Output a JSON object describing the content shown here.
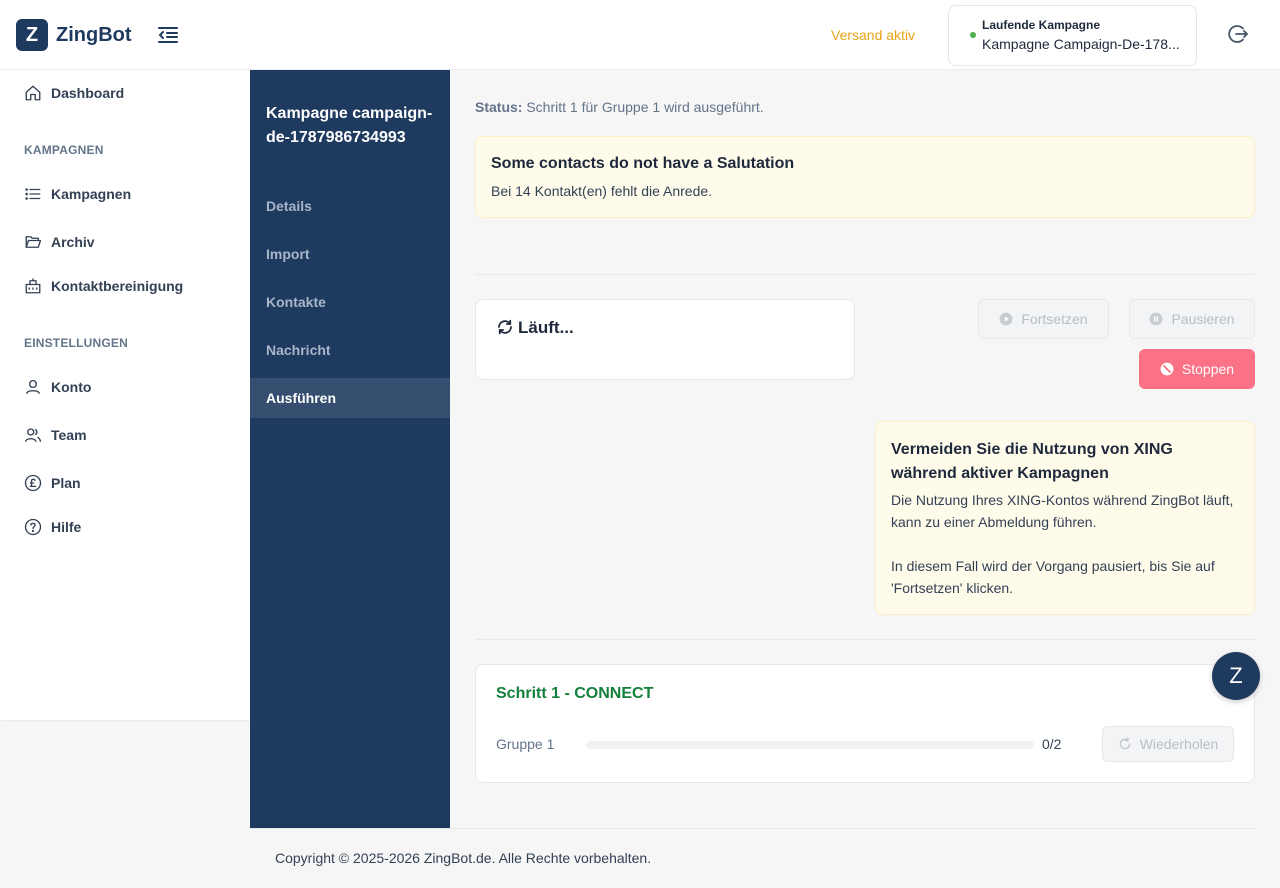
{
  "header": {
    "logo_letter": "Z",
    "app_name": "ZingBot",
    "collapse_icon": "menu-collapse-icon",
    "sending_status": "Versand aktiv",
    "running_campaign_title": "Laufende Kampagne",
    "running_campaign_name": "Kampagne Campaign-De-178...",
    "running_status_color": "#4caf50",
    "logout_icon": "logout-icon"
  },
  "sidebar": {
    "dashboard": "Dashboard",
    "section_campaigns": "KAMPAGNEN",
    "campaigns": "Kampagnen",
    "archive": "Archiv",
    "contact_cleanup": "Kontaktbereinigung",
    "section_settings": "EINSTELLUNGEN",
    "account": "Konto",
    "team": "Team",
    "plan": "Plan",
    "help": "Hilfe"
  },
  "subnav": {
    "title": "Kampagne campaign-de-1787986734993",
    "items": [
      "Details",
      "Import",
      "Kontakte",
      "Nachricht",
      "Ausführen"
    ],
    "active_index": 4
  },
  "main": {
    "status_label": "Status:",
    "status_text": "Schritt 1 für Gruppe 1 wird ausgeführt.",
    "salutation_warning_title": "Some contacts do not have a Salutation",
    "salutation_warning_text": "Bei 14 Kontakt(en) fehlt die Anrede.",
    "running_label": "Läuft...",
    "resume_button": "Fortsetzen",
    "pause_button": "Pausieren",
    "stop_button": "Stoppen",
    "xing_warning_title": "Vermeiden Sie die Nutzung von XING während aktiver Kampagnen",
    "xing_warning_text_1": "Die Nutzung Ihres XING-Kontos während ZingBot läuft, kann zu einer Abmeldung führen.",
    "xing_warning_text_2": "In diesem Fall wird der Vorgang pausiert, bis Sie auf 'Fortsetzen' klicken.",
    "step_title": "Schritt 1 - CONNECT",
    "group_label": "Gruppe 1",
    "group_progress": "0/2",
    "group_progress_fraction": 0,
    "retry_button": "Wiederholen"
  },
  "fab_letter": "Z",
  "footer": "Copyright © 2025-2026 ZingBot.de. Alle Rechte vorbehalten.",
  "colors": {
    "brand": "#1e3a5f",
    "warning_text": "#e8a317",
    "stop": "#fb7185",
    "step_success": "#15803d"
  }
}
